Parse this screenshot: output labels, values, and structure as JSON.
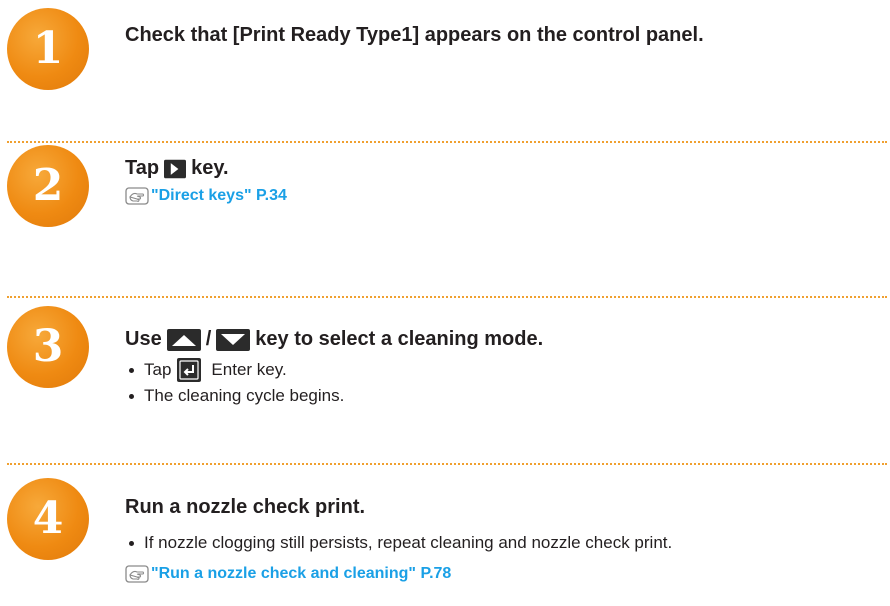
{
  "steps": [
    {
      "number": "1",
      "heading": "Check that [Print Ready  Type1] appears on the control panel."
    },
    {
      "number": "2",
      "heading_before": "Tap",
      "heading_key_icon": "right-arrow-key-icon",
      "heading_after": "key.",
      "reference": "\"Direct keys\" P.34"
    },
    {
      "number": "3",
      "heading_before": "Use",
      "heading_key_icon_1": "up-arrow-key-icon",
      "heading_separator": "/",
      "heading_key_icon_2": "down-arrow-key-icon",
      "heading_after": "key to select a cleaning mode.",
      "bullets": [
        {
          "before": "Tap",
          "icon": "enter-key-icon",
          "after": "Enter key."
        },
        {
          "text": "The cleaning cycle begins."
        }
      ]
    },
    {
      "number": "4",
      "heading": "Run a nozzle check print.",
      "bullets": [
        {
          "text": "If nozzle clogging still persists, repeat cleaning and nozzle check print."
        }
      ],
      "reference": "\"Run a nozzle check and cleaning\" P.78"
    }
  ],
  "colors": {
    "accent_orange": "#ef8a12",
    "link_blue": "#1aa0e6",
    "text": "#231f20",
    "divider": "#f0a030",
    "key_icon": "#2b2b2b"
  }
}
